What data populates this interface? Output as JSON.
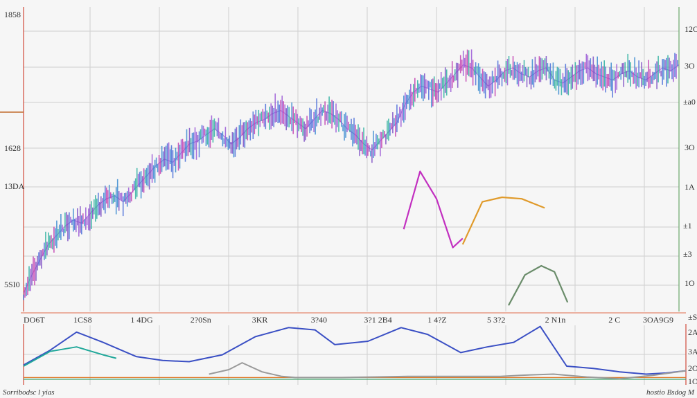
{
  "chart_data": [
    {
      "type": "line",
      "panel": "price",
      "title": "",
      "xlabel": "",
      "ylabel": "",
      "grid": true,
      "legend": "none",
      "left_tick_labels": [
        "1858",
        "1628",
        "13DA",
        "5SI0"
      ],
      "right_tick_labels": [
        "12O",
        "3O",
        "±a0",
        "3O",
        "1A",
        "±1",
        "±3",
        "1O"
      ],
      "xlim": [
        0,
        100
      ],
      "ylim": [
        0,
        100
      ],
      "series": [
        {
          "color": "#9b59d6",
          "values": [
            6,
            12,
            17,
            22,
            25,
            28,
            30,
            29,
            32,
            35,
            37,
            38,
            36,
            39,
            42,
            45,
            48,
            50,
            49,
            52,
            55,
            56,
            58,
            60,
            58,
            55,
            57,
            60,
            62,
            63,
            65,
            66,
            64,
            62,
            60,
            63,
            66,
            65,
            63,
            60,
            58,
            55,
            53,
            56,
            59,
            62,
            68,
            72,
            74,
            73,
            72,
            75,
            78,
            81,
            80,
            77,
            74,
            76,
            79,
            80,
            78,
            77,
            79,
            80,
            76,
            75,
            77,
            79,
            80,
            78,
            77,
            76,
            78,
            79,
            77,
            76,
            78,
            80,
            79,
            81
          ]
        }
      ],
      "overlay_lines": [
        {
          "color": "#c22fc0",
          "x": [
            58.0,
            60.5,
            63.0,
            65.5,
            67.0
          ],
          "y": [
            27.0,
            46.0,
            37.0,
            21.0,
            24.0
          ]
        },
        {
          "color": "#e09a2a",
          "x": [
            67.0,
            70.0,
            73.0,
            76.0,
            79.5
          ],
          "y": [
            22.0,
            36.0,
            37.5,
            37.0,
            34.0
          ]
        },
        {
          "color": "#6a8c6a",
          "x": [
            74.0,
            76.5,
            79.0,
            81.0,
            83.0
          ],
          "y": [
            2.0,
            12.0,
            15.0,
            13.0,
            3.0
          ]
        }
      ]
    },
    {
      "type": "line",
      "panel": "indicator",
      "x_tick_labels": [
        "DO6T",
        "1CS8",
        "1 4DG",
        "2?0Sn",
        "3KR",
        "3?40",
        "3?1 2B4",
        "1 4?Z",
        "5 3?2",
        "2 N1n",
        "2 C",
        "3OA9G9"
      ],
      "right_tick_labels": [
        "±S",
        "2A",
        "3A",
        "2O",
        "1O"
      ],
      "xlim": [
        0,
        100
      ],
      "ylim": [
        0,
        100
      ],
      "series": [
        {
          "color": "#3a4fc4",
          "x": [
            0,
            4,
            8,
            12,
            17,
            21,
            25,
            30,
            35,
            40,
            44,
            47,
            52,
            57,
            61,
            66,
            70,
            74,
            78,
            82,
            86,
            90,
            94,
            97,
            100
          ],
          "y": [
            30,
            56,
            88,
            70,
            45,
            38,
            36,
            48,
            80,
            96,
            92,
            66,
            72,
            96,
            84,
            52,
            62,
            70,
            98,
            28,
            24,
            18,
            14,
            16,
            20
          ]
        },
        {
          "color": "#21a89a",
          "x": [
            0,
            4,
            8,
            12,
            14
          ],
          "y": [
            28,
            54,
            62,
            48,
            42
          ]
        },
        {
          "color": "#9a9a9a",
          "x": [
            28,
            31,
            33,
            36,
            39,
            41,
            44,
            48,
            53,
            58,
            63,
            68,
            72,
            75,
            80,
            85,
            90,
            95,
            100
          ],
          "y": [
            14,
            22,
            34,
            18,
            10,
            8,
            8,
            8,
            9,
            10,
            10,
            10,
            10,
            12,
            14,
            9,
            6,
            12,
            20
          ]
        }
      ],
      "baselines": [
        {
          "color": "#2f9a5c",
          "y": 5
        },
        {
          "color": "#e07a2a",
          "y": 8
        }
      ]
    }
  ],
  "footer": {
    "left": "Sorribodsc l yias",
    "right": "hostio Bsdog M"
  },
  "colors": {
    "grid": "#cfcfcf",
    "left_axis": "#d04a3a",
    "right_axis": "#6aa86a",
    "marker": "#c06a2a",
    "background": "#f6f6f6"
  }
}
